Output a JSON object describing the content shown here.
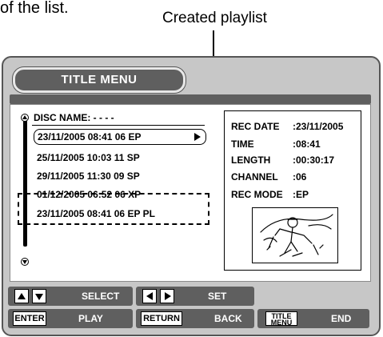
{
  "intro_text": "of the list.",
  "callout": "Created playlist",
  "title_menu": "TITLE MENU",
  "disc_name_label": "DISC NAME: - - - -",
  "titles": [
    "23/11/2005 08:41 06 EP",
    "25/11/2005 10:03 11 SP",
    "29/11/2005 11:30 09 SP",
    "01/12/2005 06:52 06 XP",
    "23/11/2005 08:41 06 EP PL"
  ],
  "info": [
    {
      "label": "REC DATE",
      "value": ":23/11/2005"
    },
    {
      "label": "TIME",
      "value": ":08:41"
    },
    {
      "label": "LENGTH",
      "value": ":00:30:17"
    },
    {
      "label": "CHANNEL",
      "value": ":06"
    },
    {
      "label": "REC MODE",
      "value": ":EP"
    }
  ],
  "controls": {
    "select": "SELECT",
    "set": "SET",
    "enter_key": "ENTER",
    "play": "PLAY",
    "return_key": "RETURN",
    "back": "BACK",
    "title_menu_key_line1": "TITLE",
    "title_menu_key_line2": "MENU",
    "end": "END"
  },
  "colors": {
    "bar": "#5f5f5f",
    "frame": "#c7c7c7"
  },
  "icons": [
    "scroll-up-icon",
    "scroll-down-icon",
    "play-arrow-icon",
    "up-key-icon",
    "down-key-icon",
    "left-key-icon",
    "right-key-icon",
    "skier-thumbnail"
  ]
}
